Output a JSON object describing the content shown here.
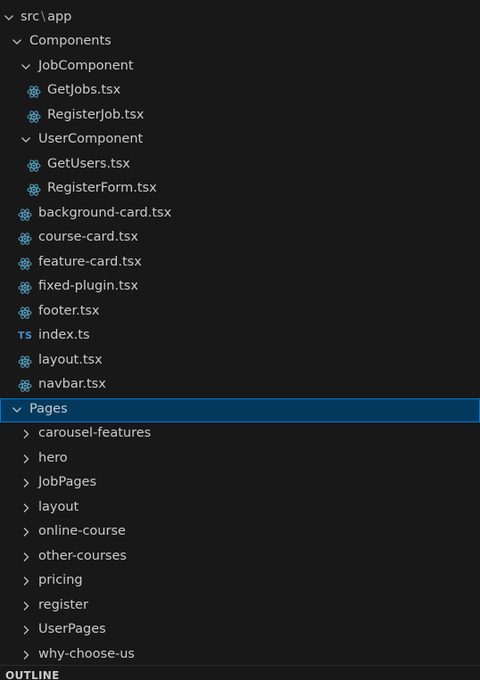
{
  "explorer": {
    "top_partial_label": "·",
    "root": {
      "folder": "src",
      "separator": "\\",
      "subfolder": "app"
    },
    "components": {
      "label": "Components",
      "job_component": {
        "label": "JobComponent",
        "files": [
          "GetJobs.tsx",
          "RegisterJob.tsx"
        ]
      },
      "user_component": {
        "label": "UserComponent",
        "files": [
          "GetUsers.tsx",
          "RegisterForm.tsx"
        ]
      },
      "files": [
        "background-card.tsx",
        "course-card.tsx",
        "feature-card.tsx",
        "fixed-plugin.tsx",
        "footer.tsx",
        "index.ts",
        "layout.tsx",
        "navbar.tsx"
      ]
    },
    "pages": {
      "label": "Pages",
      "folders": [
        "carousel-features",
        "hero",
        "JobPages",
        "layout",
        "online-course",
        "other-courses",
        "pricing",
        "register",
        "UserPages",
        "why-choose-us"
      ]
    }
  },
  "outline": {
    "title": "OUTLINE"
  },
  "icons": {
    "react_file": "react-icon",
    "typescript_file": "ts-icon",
    "chevron_open": "chevron-down-icon",
    "chevron_closed": "chevron-right-icon"
  },
  "colors": {
    "background": "#181818",
    "selection_background": "#04395e",
    "selection_border": "#0078d4",
    "text": "#cccccc",
    "react_icon": "#519aba",
    "ts_icon": "#4d8fcc"
  }
}
